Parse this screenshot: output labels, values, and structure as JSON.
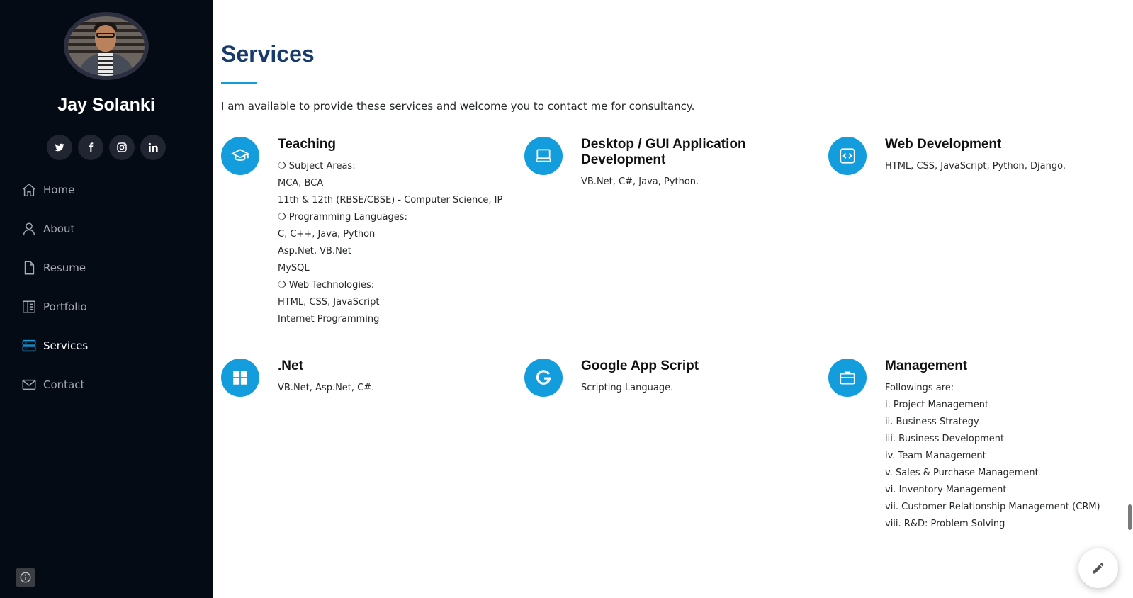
{
  "profile": {
    "name": "Jay Solanki"
  },
  "social": [
    "twitter-icon",
    "facebook-icon",
    "instagram-icon",
    "linkedin-icon"
  ],
  "nav": {
    "items": [
      {
        "label": "Home",
        "icon": "home-icon"
      },
      {
        "label": "About",
        "icon": "user-icon"
      },
      {
        "label": "Resume",
        "icon": "file-icon"
      },
      {
        "label": "Portfolio",
        "icon": "book-icon"
      },
      {
        "label": "Services",
        "icon": "server-icon",
        "active": true
      },
      {
        "label": "Contact",
        "icon": "envelope-icon"
      }
    ]
  },
  "colors": {
    "accent": "#149ddd",
    "sidebar": "#040b14",
    "heading": "#173b6c"
  },
  "section": {
    "title": "Services",
    "intro": "I am available to provide these services and welcome you to contact me for consultancy."
  },
  "services": [
    {
      "title": "Teaching",
      "icon": "graduation-cap-icon",
      "lines": [
        "❍ Subject Areas:",
        "MCA, BCA",
        "11th & 12th (RBSE/CBSE) - Computer Science, IP",
        "❍ Programming Languages:",
        "C, C++, Java, Python",
        "Asp.Net, VB.Net",
        "MySQL",
        "❍ Web Technologies:",
        "HTML, CSS, JavaScript",
        "Internet Programming"
      ]
    },
    {
      "title": "Desktop / GUI Application Development",
      "icon": "laptop-icon",
      "lines": [
        "VB.Net, C#, Java, Python."
      ]
    },
    {
      "title": "Web Development",
      "icon": "code-icon",
      "lines": [
        "HTML, CSS, JavaScript, Python, Django."
      ]
    },
    {
      "title": ".Net",
      "icon": "windows-icon",
      "lines": [
        "VB.Net, Asp.Net, C#."
      ]
    },
    {
      "title": "Google App Script",
      "icon": "google-icon",
      "lines": [
        "Scripting Language."
      ]
    },
    {
      "title": "Management",
      "icon": "briefcase-icon",
      "lines": [
        "Followings are:",
        "i. Project Management",
        "ii. Business Strategy",
        "iii. Business Development",
        "iv. Team Management",
        "v. Sales & Purchase Management",
        "vi. Inventory Management",
        "vii. Customer Relationship Management (CRM)",
        "viii. R&D: Problem Solving"
      ]
    }
  ]
}
